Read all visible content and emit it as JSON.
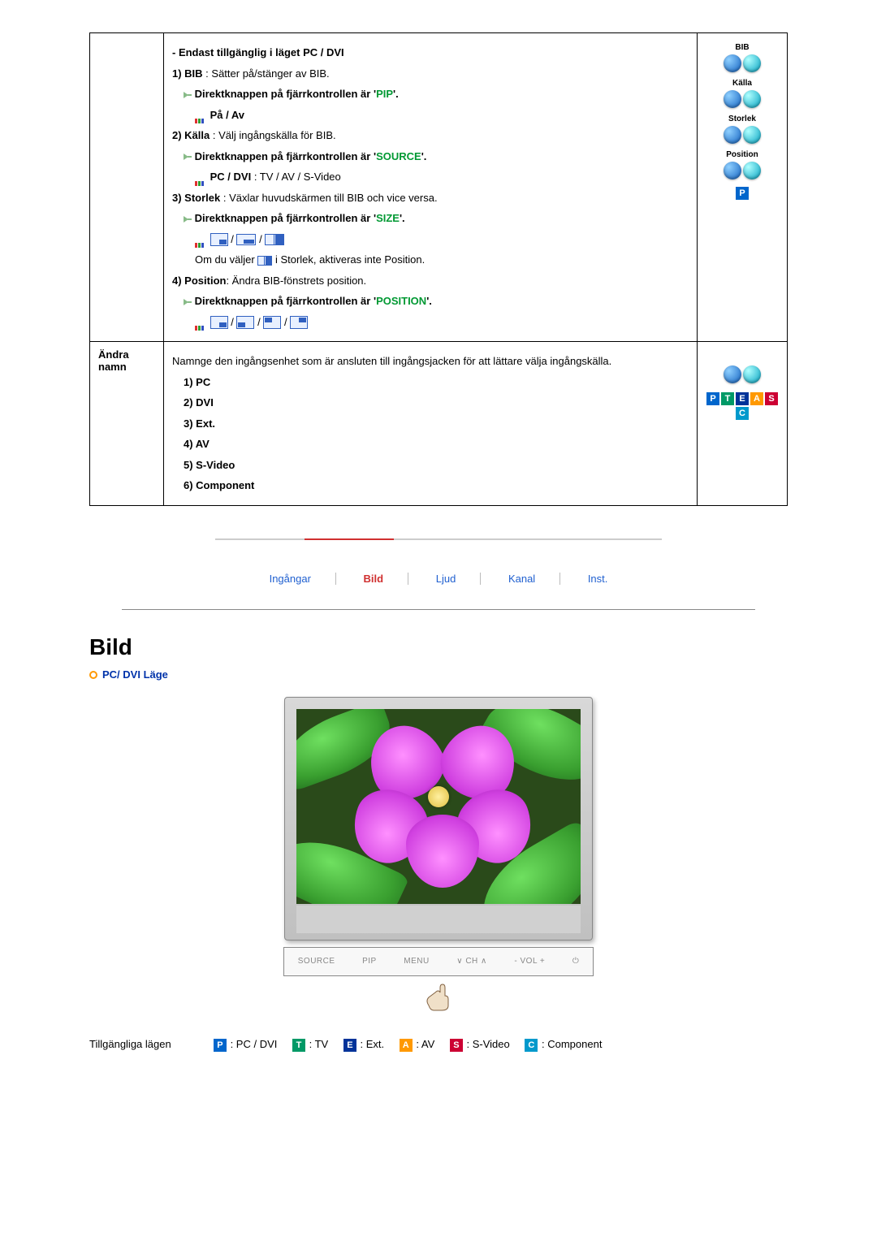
{
  "row1": {
    "header": " - Endast tillgänglig i läget PC / DVI",
    "bib_line": "1) BIB : Sätter på/stänger av BIB.",
    "remote_prefix": "Direktknappen på fjärrkontrollen är '",
    "remote_suffix": "'.",
    "pip": "PIP",
    "on_off": "På / Av",
    "source_line": "2) Källa : Välj ingångskälla för BIB.",
    "source": "SOURCE",
    "pcdvi": "PC / DVI",
    "pcdvi_rest": " : TV / AV / S-Video",
    "size_line": "3) Storlek : Växlar huvudskärmen till BIB och vice versa.",
    "size": "SIZE",
    "size_note_a": "Om du väljer ",
    "size_note_b": " i Storlek, aktiveras inte Position.",
    "pos_line": "4) Position: Ändra BIB-fönstrets position.",
    "position": "POSITION",
    "icon_bib": "BIB",
    "icon_kalla": "Källa",
    "icon_storlek": "Storlek",
    "icon_position": "Position"
  },
  "row2": {
    "label": "Ändra namn",
    "desc": "Namnge den ingångsenhet som är ansluten till ingångsjacken för att lättare välja ingångskälla.",
    "items": [
      "1) PC",
      "2) DVI",
      "3) Ext.",
      "4) AV",
      "5) S-Video",
      "6) Component"
    ]
  },
  "tabs": [
    "Ingångar",
    "Bild",
    "Ljud",
    "Kanal",
    "Inst."
  ],
  "active_tab": 1,
  "heading": "Bild",
  "subhead": "PC/ DVI Läge",
  "buttons": [
    "SOURCE",
    "PIP",
    "MENU",
    "∨  CH  ∧",
    "-    VOL  +",
    "⏻"
  ],
  "legend": {
    "label": "Tillgängliga lägen",
    "items": [
      {
        "badge": "P",
        "cls": "bg-p",
        "text": ": PC / DVI"
      },
      {
        "badge": "T",
        "cls": "bg-t",
        "text": ": TV"
      },
      {
        "badge": "E",
        "cls": "bg-e",
        "text": ": Ext."
      },
      {
        "badge": "A",
        "cls": "bg-a",
        "text": ": AV"
      },
      {
        "badge": "S",
        "cls": "bg-s",
        "text": ": S-Video"
      },
      {
        "badge": "C",
        "cls": "bg-c",
        "text": ": Component"
      }
    ]
  },
  "slash": " / "
}
